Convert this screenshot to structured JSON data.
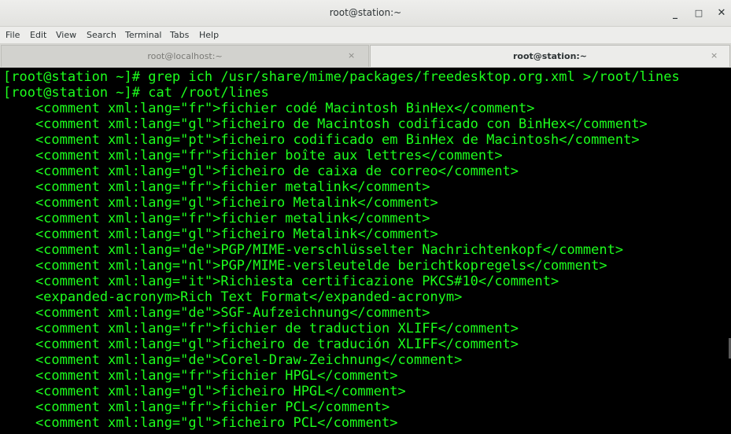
{
  "window": {
    "title": "root@station:~",
    "controls": {
      "minimize": "_",
      "maximize": "□",
      "close": "✕"
    }
  },
  "menu": [
    "File",
    "Edit",
    "View",
    "Search",
    "Terminal",
    "Tabs",
    "Help"
  ],
  "tabs": [
    {
      "label": "root@localhost:~",
      "active": false,
      "close": "×"
    },
    {
      "label": "root@station:~",
      "active": true,
      "close": "×"
    }
  ],
  "terminal": {
    "text_color": "#1dff1d",
    "background": "#000000",
    "lines": [
      "[root@station ~]# grep ich /usr/share/mime/packages/freedesktop.org.xml >/root/lines",
      "[root@station ~]# cat /root/lines",
      "    <comment xml:lang=\"fr\">fichier codé Macintosh BinHex</comment>",
      "    <comment xml:lang=\"gl\">ficheiro de Macintosh codificado con BinHex</comment>",
      "    <comment xml:lang=\"pt\">ficheiro codificado em BinHex de Macintosh</comment>",
      "    <comment xml:lang=\"fr\">fichier boîte aux lettres</comment>",
      "    <comment xml:lang=\"gl\">ficheiro de caixa de correo</comment>",
      "    <comment xml:lang=\"fr\">fichier metalink</comment>",
      "    <comment xml:lang=\"gl\">ficheiro Metalink</comment>",
      "    <comment xml:lang=\"fr\">fichier metalink</comment>",
      "    <comment xml:lang=\"gl\">ficheiro Metalink</comment>",
      "    <comment xml:lang=\"de\">PGP/MIME-verschlüsselter Nachrichtenkopf</comment>",
      "    <comment xml:lang=\"nl\">PGP/MIME-versleutelde berichtkopregels</comment>",
      "    <comment xml:lang=\"it\">Richiesta certificazione PKCS#10</comment>",
      "    <expanded-acronym>Rich Text Format</expanded-acronym>",
      "    <comment xml:lang=\"de\">SGF-Aufzeichnung</comment>",
      "    <comment xml:lang=\"fr\">fichier de traduction XLIFF</comment>",
      "    <comment xml:lang=\"gl\">ficheiro de tradución XLIFF</comment>",
      "    <comment xml:lang=\"de\">Corel-Draw-Zeichnung</comment>",
      "    <comment xml:lang=\"fr\">fichier HPGL</comment>",
      "    <comment xml:lang=\"gl\">ficheiro HPGL</comment>",
      "    <comment xml:lang=\"fr\">fichier PCL</comment>",
      "    <comment xml:lang=\"gl\">ficheiro PCL</comment>"
    ]
  }
}
